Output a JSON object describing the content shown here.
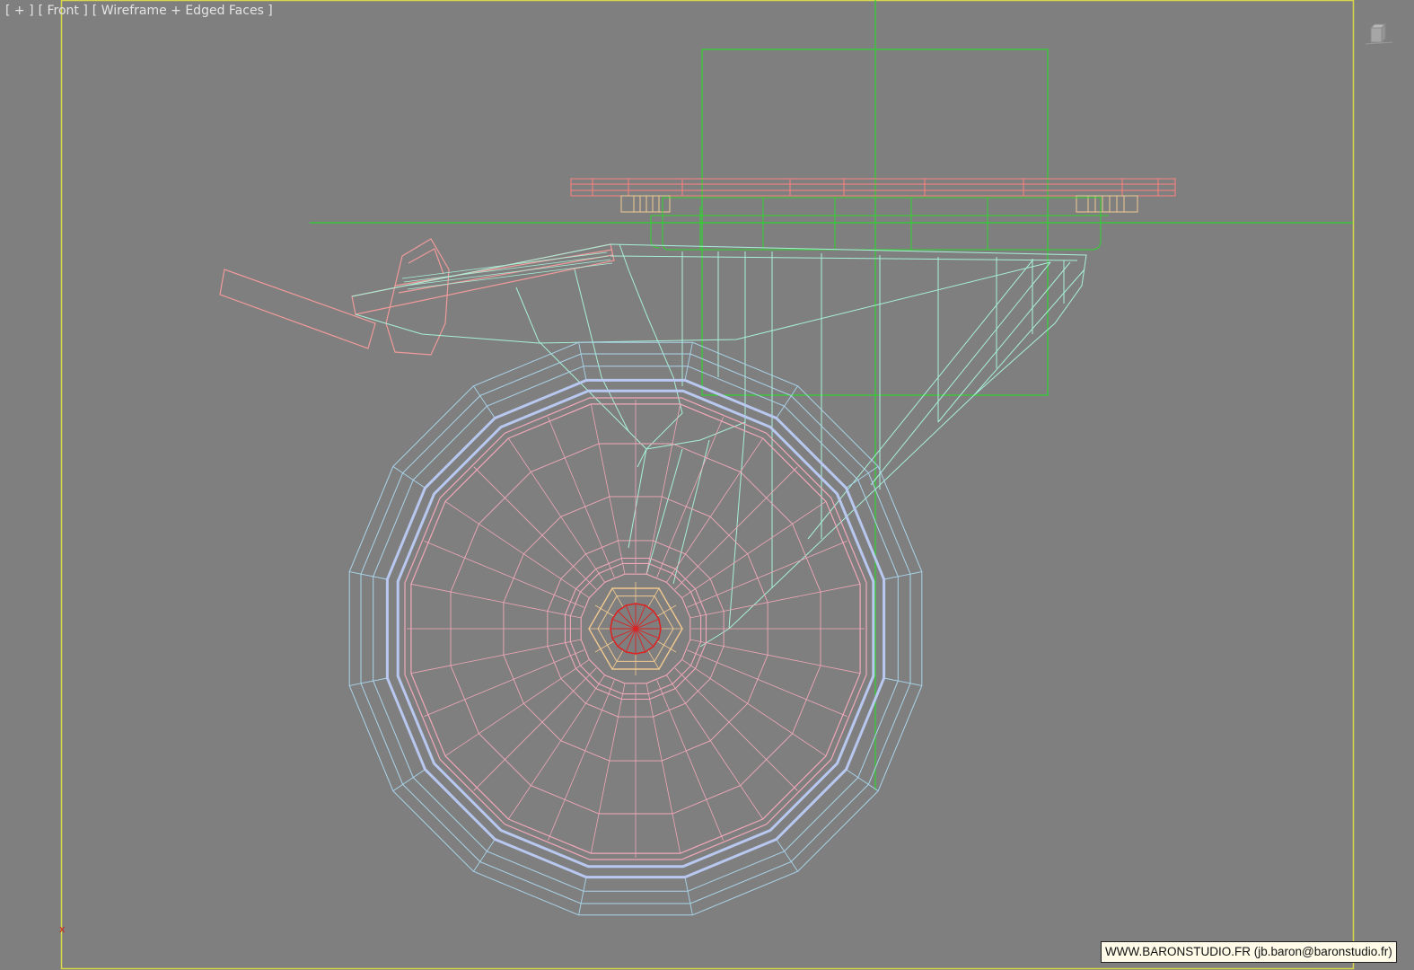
{
  "viewport": {
    "label_parts": [
      "[ + ]",
      "[ Front ]",
      "[ Wireframe + Edged Faces ]"
    ],
    "view_name": "Front",
    "render_mode": "Wireframe + Edged Faces",
    "axis_indicator": "x"
  },
  "watermark": {
    "text": "WWW.BARONSTUDIO.FR (jb.baron@baronstudio.fr)"
  },
  "colors": {
    "background": "#7f7f7f",
    "viewport_border": "#d8d84a",
    "selection_green": "#2ed42e",
    "caster_body": "#a8f0d8",
    "tire_outer": "#aad4ea",
    "tire_band": "#b8c8f0",
    "rim_pink": "#f0a8b8",
    "plate_red": "#ff8080",
    "lever_pink": "#f09a9a",
    "hub_orange": "#f0c890",
    "axle_red": "#dd2222"
  }
}
